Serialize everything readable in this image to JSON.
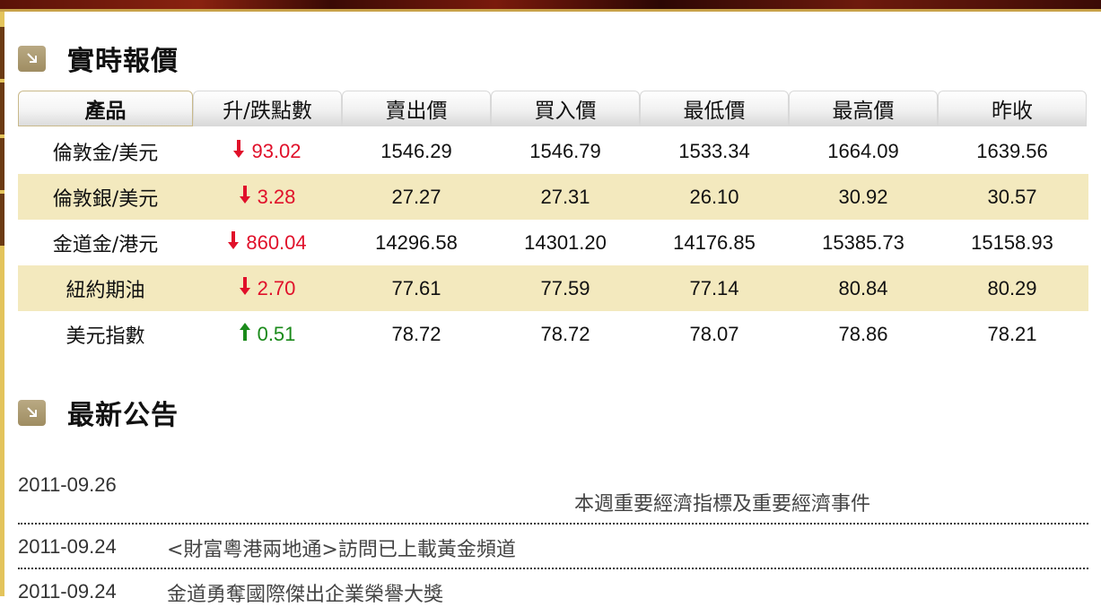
{
  "sections": {
    "quotes_title": "實時報價",
    "news_title": "最新公告"
  },
  "quotes": {
    "headers": [
      "產品",
      "升/跌點數",
      "賣出價",
      "買入價",
      "最低價",
      "最高價",
      "昨收"
    ],
    "rows": [
      {
        "name": "倫敦金/美元",
        "dir": "down",
        "change": "93.02",
        "sell": "1546.29",
        "buy": "1546.79",
        "low": "1533.34",
        "high": "1664.09",
        "prev": "1639.56"
      },
      {
        "name": "倫敦銀/美元",
        "dir": "down",
        "change": "3.28",
        "sell": "27.27",
        "buy": "27.31",
        "low": "26.10",
        "high": "30.92",
        "prev": "30.57"
      },
      {
        "name": "金道金/港元",
        "dir": "down",
        "change": "860.04",
        "sell": "14296.58",
        "buy": "14301.20",
        "low": "14176.85",
        "high": "15385.73",
        "prev": "15158.93"
      },
      {
        "name": "紐約期油",
        "dir": "down",
        "change": "2.70",
        "sell": "77.61",
        "buy": "77.59",
        "low": "77.14",
        "high": "80.84",
        "prev": "80.29"
      },
      {
        "name": "美元指數",
        "dir": "up",
        "change": "0.51",
        "sell": "78.72",
        "buy": "78.72",
        "low": "78.07",
        "high": "78.86",
        "prev": "78.21"
      }
    ]
  },
  "news": [
    {
      "date": "2011-09.26",
      "title": "本週重要經濟指標及重要經濟事件"
    },
    {
      "date": "2011-09.24",
      "title": "<財富粵港兩地通>訪問已上載黃金頻道"
    },
    {
      "date": "2011-09.24",
      "title": "金道勇奪國際傑出企業榮譽大獎"
    }
  ],
  "icons": {
    "section_icon": "arrow-down-right-icon",
    "down_arrow": "arrow-down-icon",
    "up_arrow": "arrow-up-icon"
  },
  "colors": {
    "accent_gold": "#e3c45c",
    "row_alt": "#f3e9be",
    "down": "#e0102a",
    "up": "#1a8a1a"
  }
}
